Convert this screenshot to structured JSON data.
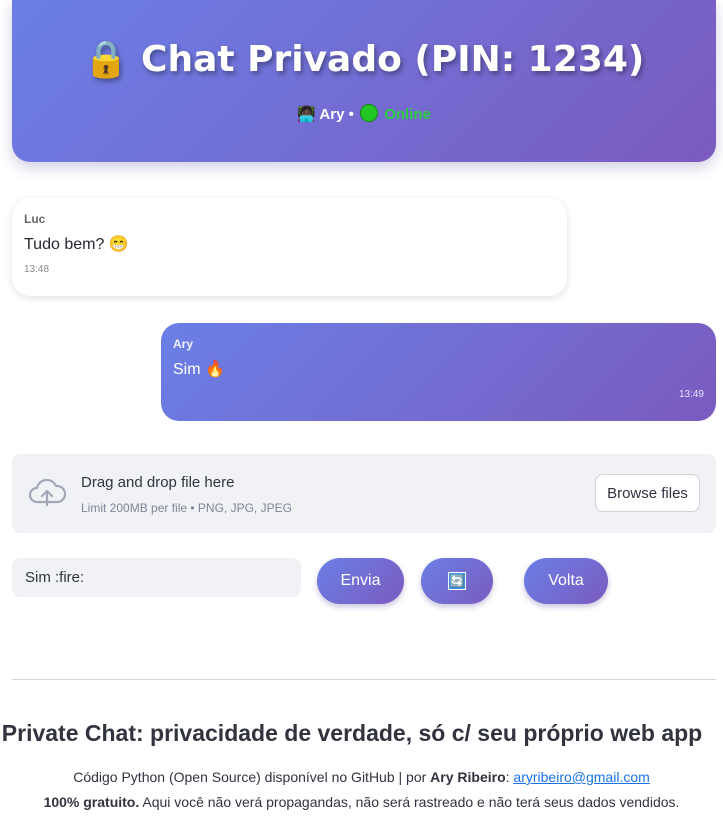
{
  "header": {
    "title": "🔒 Chat Privado (PIN: 1234)",
    "user": "👩🏿‍💻 Ary",
    "separator": "•",
    "status": "Online"
  },
  "messages": [
    {
      "sender": "Luc",
      "text": "Tudo bem? 😁",
      "time": "13:48"
    },
    {
      "sender": "Ary",
      "text": "Sim 🔥",
      "time": "13:49"
    }
  ],
  "uploader": {
    "title": "Drag and drop file here",
    "subtitle": "Limit 200MB per file • PNG, JPG, JPEG",
    "browse_label": "Browse files"
  },
  "composer": {
    "input_value": "Sim :fire:",
    "send_label": "Envia",
    "refresh_icon": "🔄",
    "back_label": "Volta"
  },
  "footer": {
    "title": "Private Chat: privacidade de verdade, só c/ seu próprio web app",
    "line1_prefix": "Código Python (Open Source) disponível no GitHub | por ",
    "author": "Ary Ribeiro",
    "colon": ": ",
    "email": "aryribeiro@gmail.com",
    "line2_bold": "100% gratuito.",
    "line2_rest": " Aqui você não verá propagandas, não será rastreado e não terá seus dados vendidos."
  },
  "colors": {
    "accent_start": "#6a7fe6",
    "accent_end": "#7b5bbf",
    "online": "#2ecc40"
  }
}
